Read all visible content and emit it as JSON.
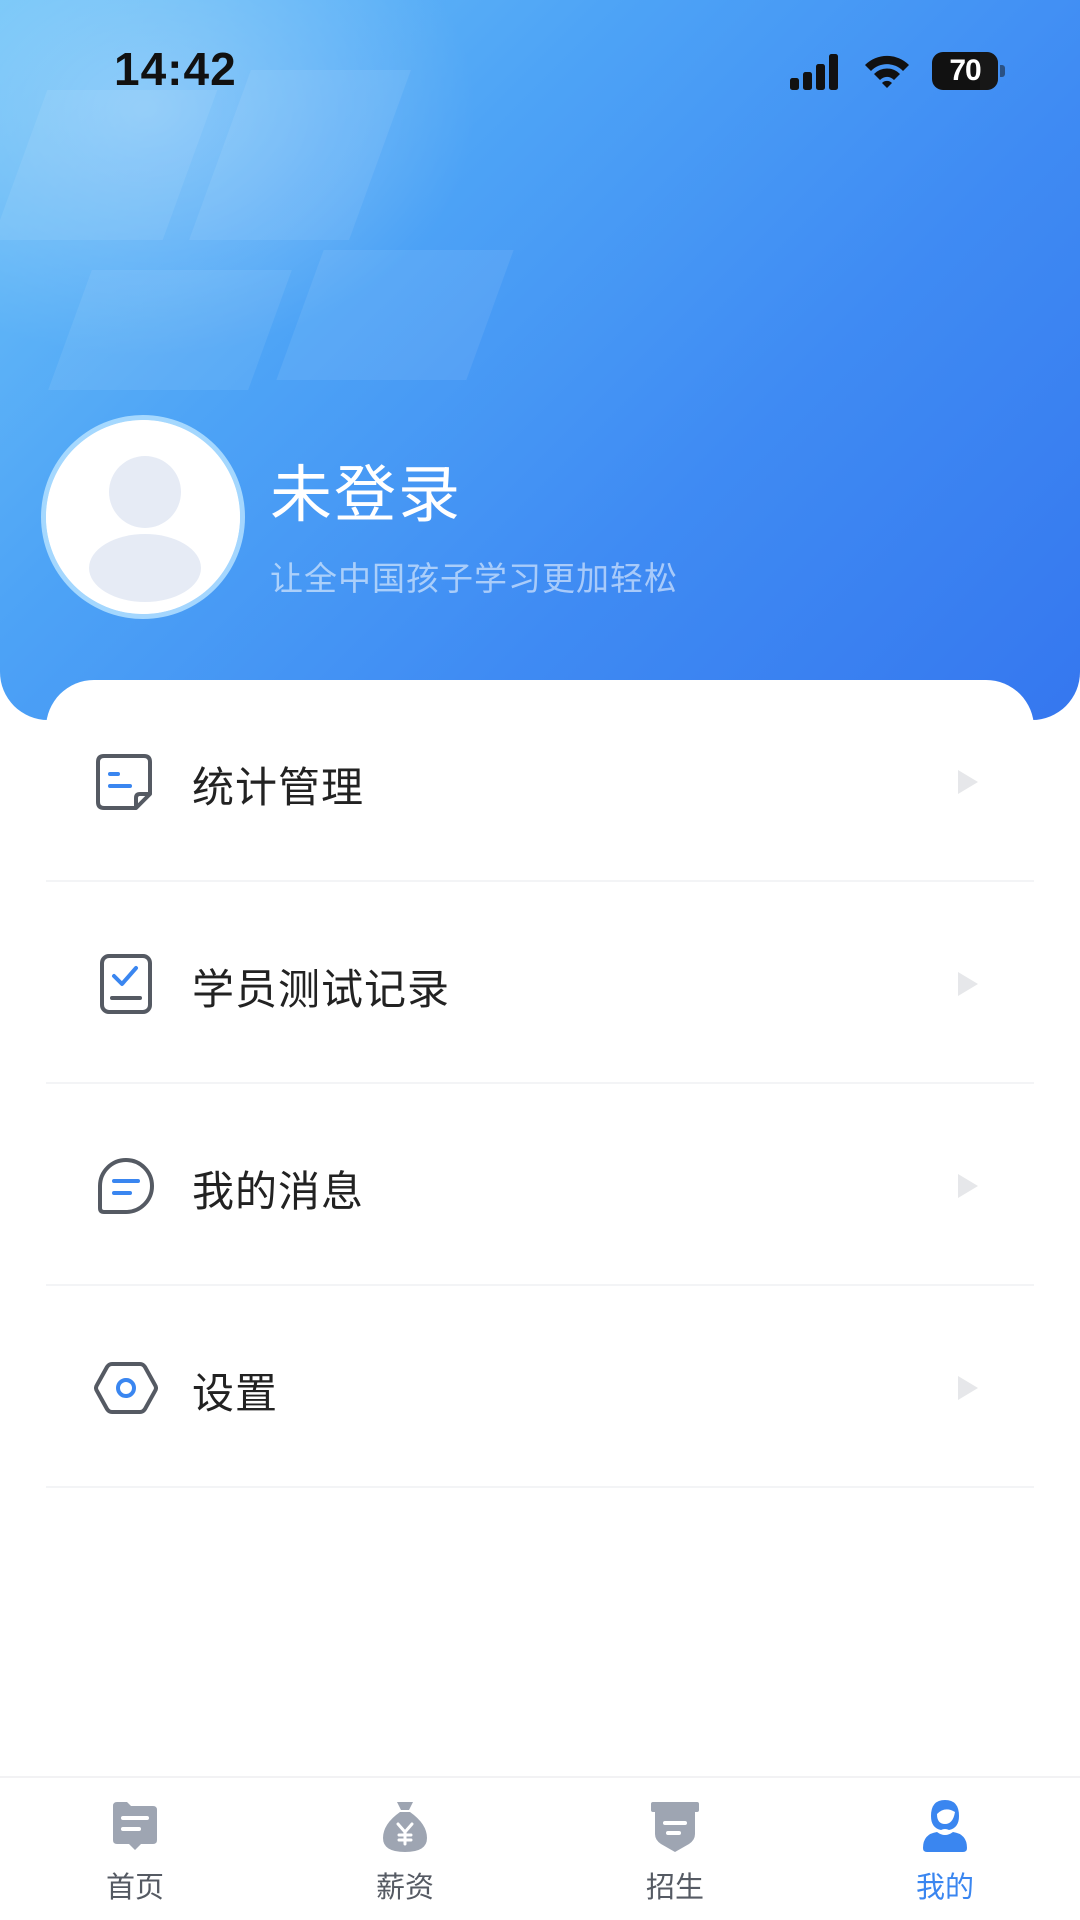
{
  "status_bar": {
    "time": "14:42",
    "battery_level": "70",
    "signal_icon": "cellular-signal-icon",
    "wifi_icon": "wifi-icon"
  },
  "profile": {
    "avatar_icon": "default-avatar-icon",
    "name": "未登录",
    "slogan": "让全中国孩子学习更加轻松"
  },
  "menu": {
    "items": [
      {
        "label": "统计管理",
        "icon": "document-stats-icon"
      },
      {
        "label": "学员测试记录",
        "icon": "checklist-clipboard-icon"
      },
      {
        "label": "我的消息",
        "icon": "message-bubble-icon"
      },
      {
        "label": "设置",
        "icon": "settings-hexagon-icon"
      }
    ]
  },
  "tabbar": {
    "items": [
      {
        "label": "首页",
        "icon": "home-icon",
        "active": false
      },
      {
        "label": "薪资",
        "icon": "money-bag-icon",
        "active": false
      },
      {
        "label": "招生",
        "icon": "enroll-badge-icon",
        "active": false
      },
      {
        "label": "我的",
        "icon": "profile-user-icon",
        "active": true
      }
    ]
  },
  "colors": {
    "header_gradient_start": "#6ec3f8",
    "header_gradient_end": "#3577ef",
    "accent": "#3a86f0",
    "icon_gray": "#555a63",
    "tab_inactive_icon": "#9ea5b2",
    "divider": "#f3f4f6"
  }
}
